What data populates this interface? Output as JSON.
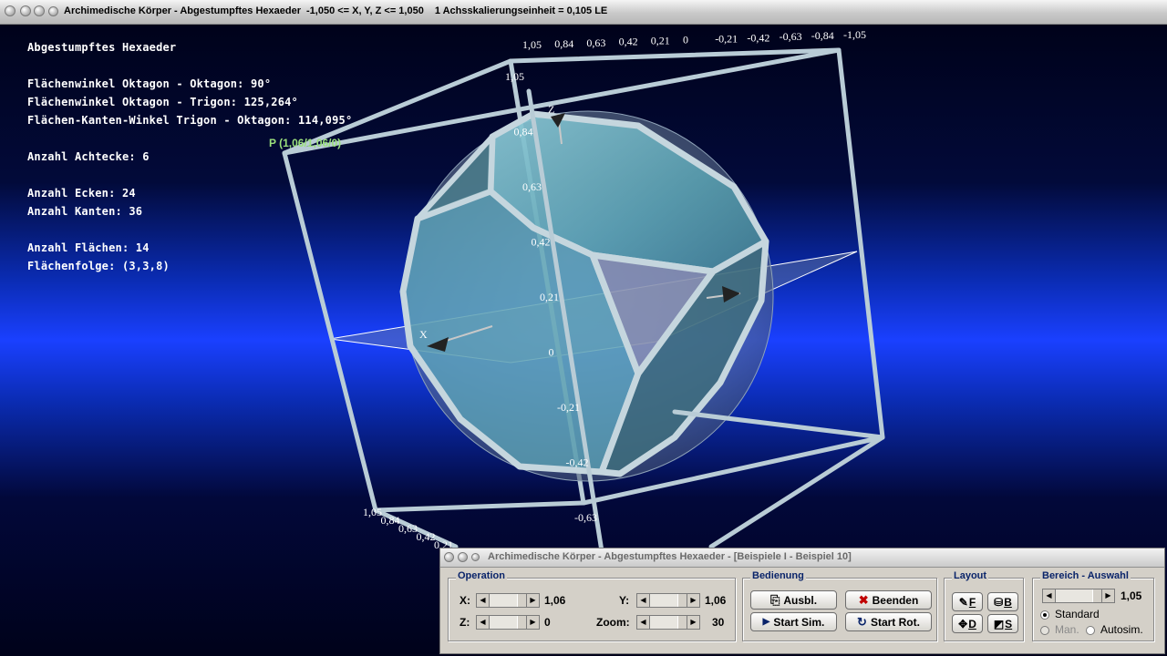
{
  "window": {
    "title": "Archimedische Körper - Abgestumpftes Hexaeder",
    "title_range": "-1,050 <= X, Y, Z <= 1,050",
    "title_scale": "1 Achsskalierungseinheit = 0,105 LE"
  },
  "info": {
    "heading": "Abgestumpftes Hexaeder",
    "angle_oo": "Flächenwinkel Oktagon - Oktagon: 90°",
    "angle_ot": "Flächenwinkel Oktagon - Trigon: 125,264°",
    "angle_edge": "Flächen-Kanten-Winkel Trigon - Oktagon: 114,095°",
    "octagons": "Anzahl Achtecke: 6",
    "vertices": "Anzahl Ecken: 24",
    "edges": "Anzahl Kanten: 36",
    "faces": "Anzahl Flächen: 14",
    "face_sequence": "Flächenfolge: (3,3,8)"
  },
  "scene": {
    "point_label": "P (1,06/1,06/0)",
    "axis_x": "X",
    "axis_z": "Z",
    "top_ticks": [
      "1,05",
      "0,84",
      "0,63",
      "0,42",
      "0,21",
      "0",
      "-0,21",
      "-0,42",
      "-0,63",
      "-0,84",
      "-1,05"
    ],
    "vertical_ticks": [
      "1,05",
      "0,84",
      "0,63",
      "0,42",
      "0,21",
      "0",
      "-0,21",
      "-0,42",
      "-0,63"
    ],
    "diagonal_ticks": [
      "1,05",
      "0,84",
      "0,63",
      "0,42",
      "0,21"
    ]
  },
  "control": {
    "title": "Archimedische Körper - Abgestumpftes Hexaeder - [Beispiele I - Beispiel 10]",
    "operation": {
      "title": "Operation",
      "x_label": "X:",
      "x_value": "1,06",
      "y_label": "Y:",
      "y_value": "1,06",
      "z_label": "Z:",
      "z_value": "0",
      "zoom_label": "Zoom:",
      "zoom_value": "30"
    },
    "bedienung": {
      "title": "Bedienung",
      "ausbl": "Ausbl.",
      "beenden": "Beenden",
      "start_sim": "Start Sim.",
      "start_rot": "Start Rot."
    },
    "layout": {
      "title": "Layout",
      "f": "F",
      "b": "B",
      "d": "D",
      "s": "S"
    },
    "bereich": {
      "title": "Bereich - Auswahl",
      "value": "1,05",
      "standard": "Standard",
      "man": "Man.",
      "autosim": "Autosim."
    }
  },
  "colors": {
    "background_mid": "#1a40ff",
    "frame": "#b9ccd6",
    "polyhedron_face": "#5fa8b8",
    "point_label": "#9be07c"
  }
}
